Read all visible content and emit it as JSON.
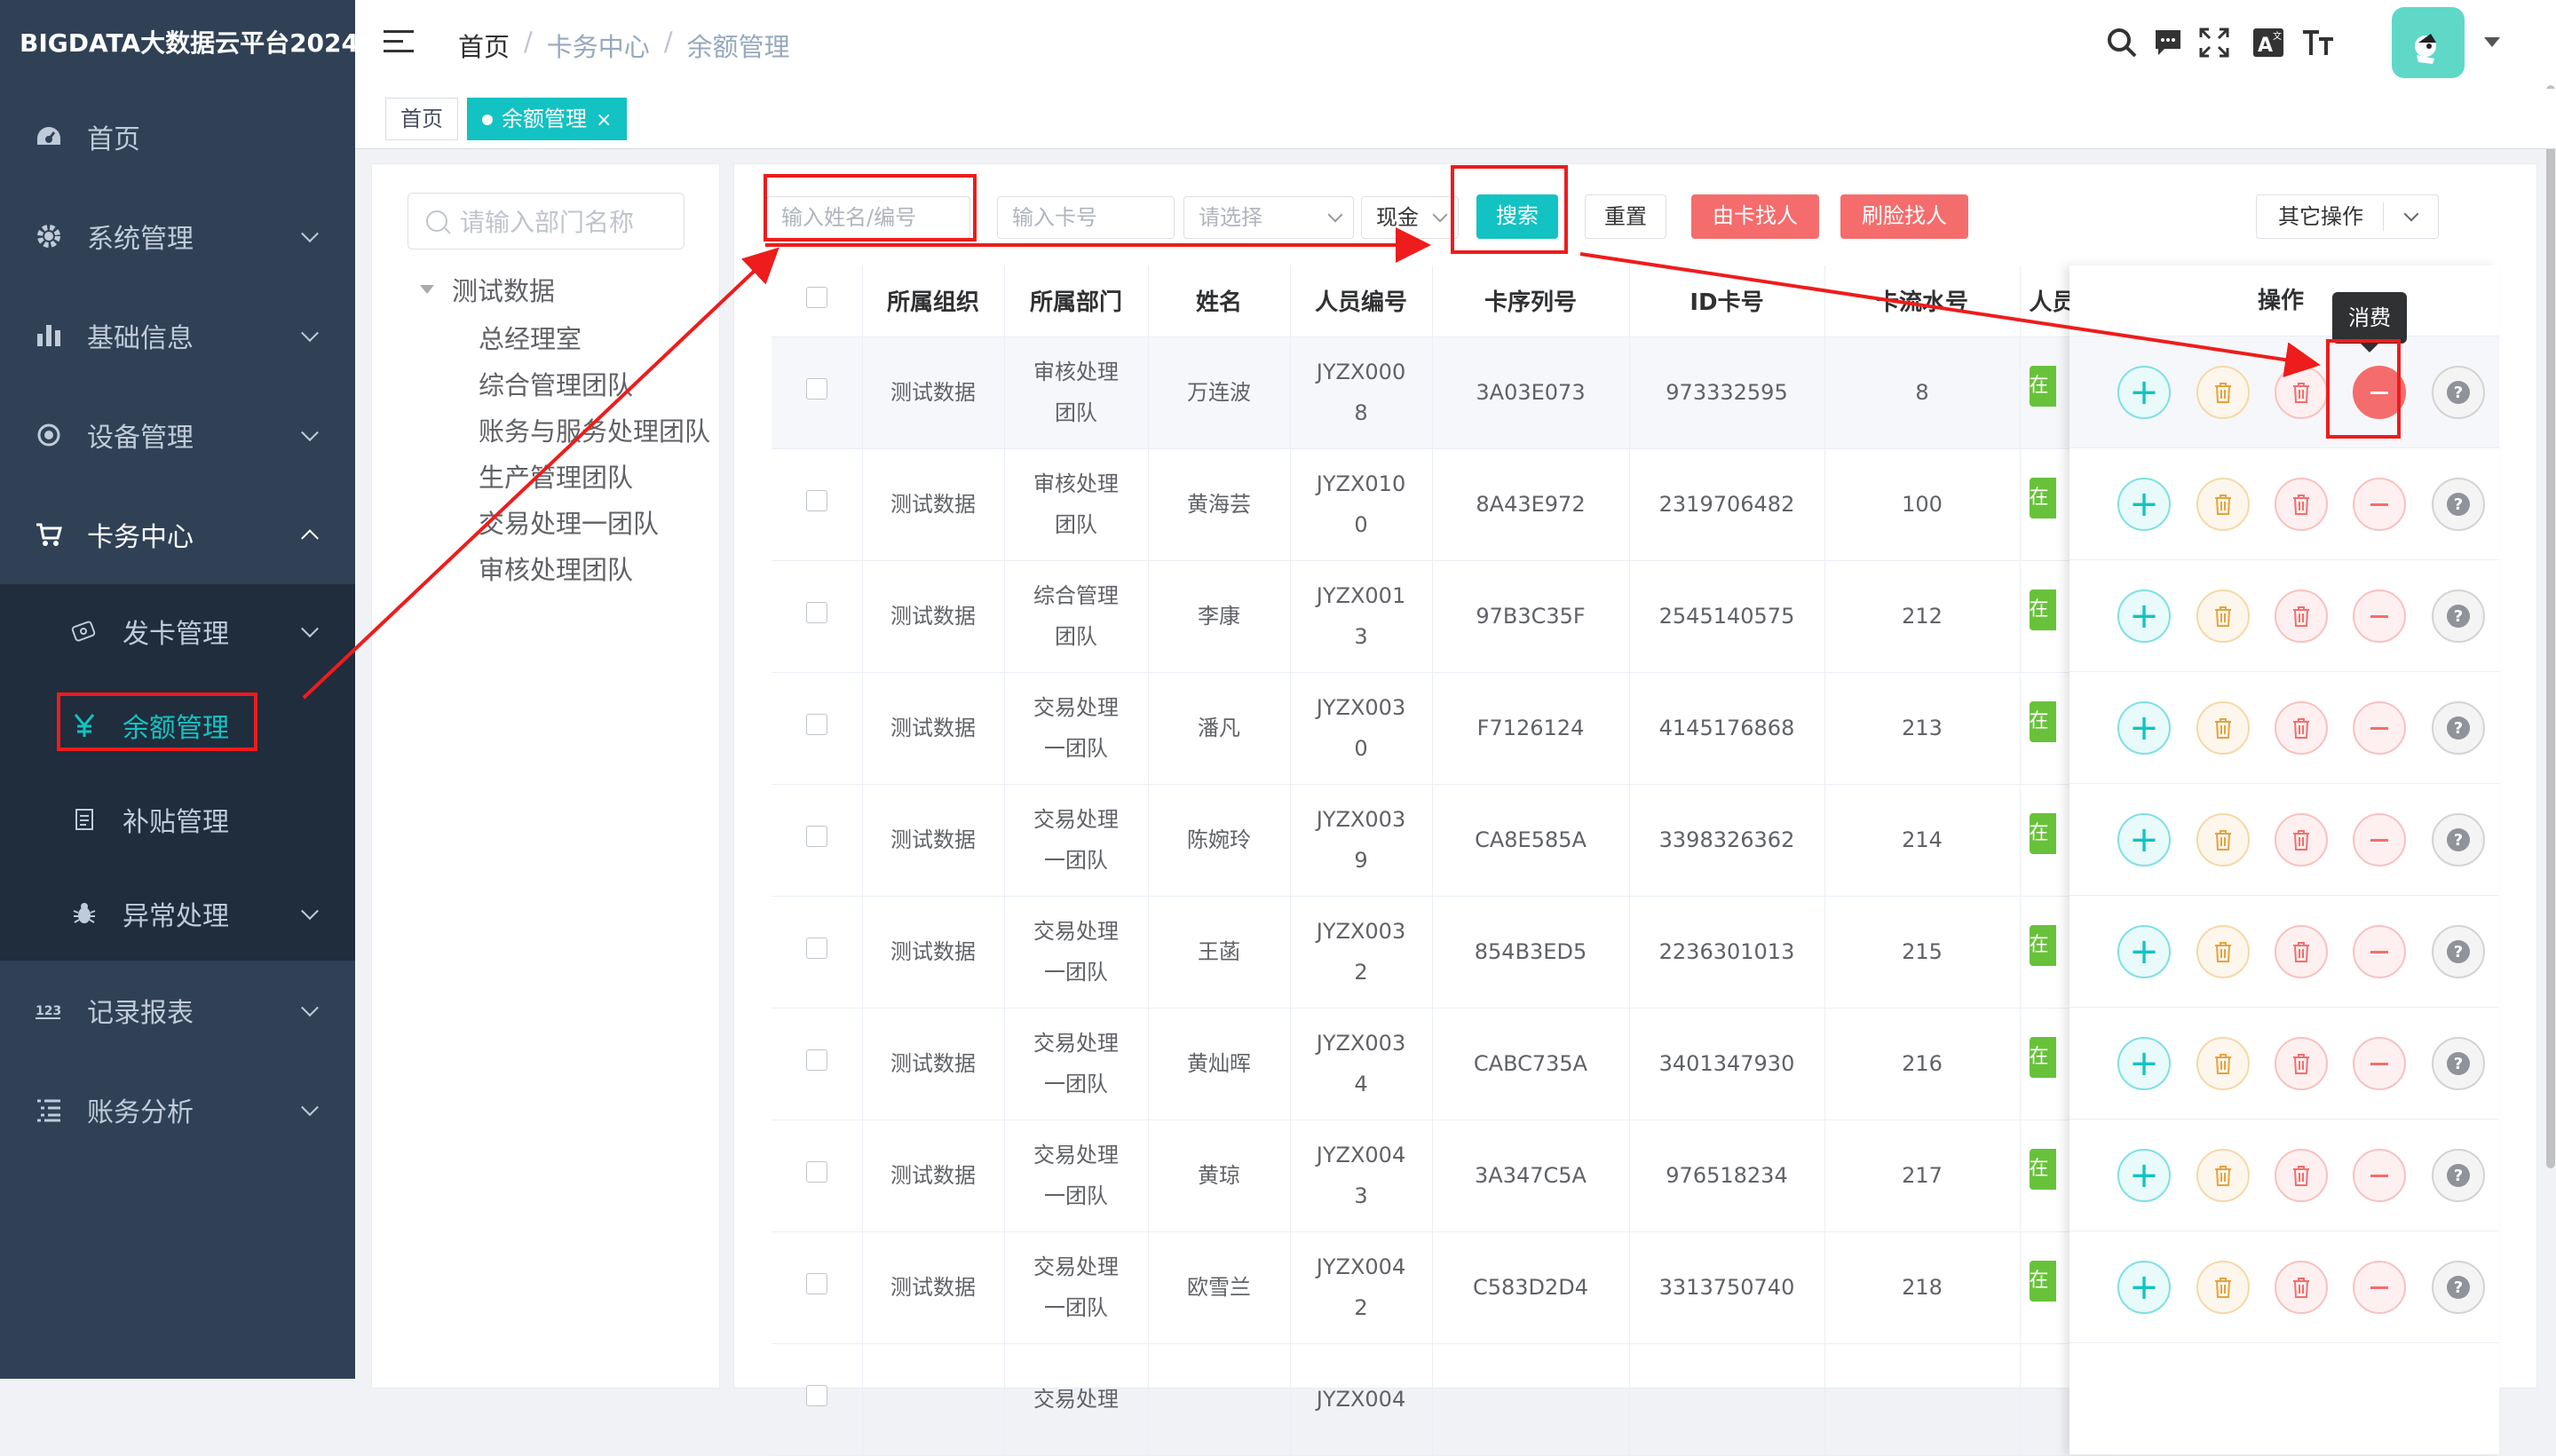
{
  "app": {
    "brand": "BIGDATA大数据云平台2024"
  },
  "sidebar": {
    "items": [
      {
        "label": "首页",
        "icon": "dashboard-icon"
      },
      {
        "label": "系统管理",
        "icon": "gear-icon"
      },
      {
        "label": "基础信息",
        "icon": "bar-chart-icon"
      },
      {
        "label": "设备管理",
        "icon": "target-icon"
      },
      {
        "label": "卡务中心",
        "icon": "cart-icon"
      },
      {
        "label": "记录报表",
        "icon": "number-icon"
      },
      {
        "label": "账务分析",
        "icon": "list-icon"
      }
    ],
    "submenu": [
      {
        "label": "发卡管理",
        "icon": "card-icon"
      },
      {
        "label": "余额管理",
        "icon": "yen-icon"
      },
      {
        "label": "补贴管理",
        "icon": "document-icon"
      },
      {
        "label": "异常处理",
        "icon": "bug-icon"
      }
    ]
  },
  "breadcrumb": [
    "首页",
    "卡务中心",
    "余额管理"
  ],
  "tags": {
    "home": "首页",
    "current": "余额管理",
    "close": "×"
  },
  "tree": {
    "search_placeholder": "请输入部门名称",
    "root": "测试数据",
    "children": [
      "总经理室",
      "综合管理团队",
      "账务与服务处理团队",
      "生产管理团队",
      "交易处理一团队",
      "审核处理团队"
    ]
  },
  "filters": {
    "name_placeholder": "输入姓名/编号",
    "card_placeholder": "输入卡号",
    "select_placeholder": "请选择",
    "cash_value": "现金",
    "search_label": "搜索",
    "reset_label": "重置",
    "find_by_card_label": "由卡找人",
    "face_find_label": "刷脸找人",
    "other_ops_label": "其它操作"
  },
  "table": {
    "headers": [
      "所属组织",
      "所属部门",
      "姓名",
      "人员编号",
      "卡序列号",
      "ID卡号",
      "卡流水号",
      "人员"
    ],
    "ops_header": "操作",
    "rows": [
      {
        "org": "测试数据",
        "dept": [
          "审核处理",
          "团队"
        ],
        "name": "万连波",
        "emp_no": [
          "JYZX000",
          "8"
        ],
        "serial": "3A03E073",
        "id_card": "973332595",
        "flow": "8",
        "status": "在"
      },
      {
        "org": "测试数据",
        "dept": [
          "审核处理",
          "团队"
        ],
        "name": "黄海芸",
        "emp_no": [
          "JYZX010",
          "0"
        ],
        "serial": "8A43E972",
        "id_card": "2319706482",
        "flow": "100",
        "status": "在"
      },
      {
        "org": "测试数据",
        "dept": [
          "综合管理",
          "团队"
        ],
        "name": "李康",
        "emp_no": [
          "JYZX001",
          "3"
        ],
        "serial": "97B3C35F",
        "id_card": "2545140575",
        "flow": "212",
        "status": "在"
      },
      {
        "org": "测试数据",
        "dept": [
          "交易处理",
          "一团队"
        ],
        "name": "潘凡",
        "emp_no": [
          "JYZX003",
          "0"
        ],
        "serial": "F7126124",
        "id_card": "4145176868",
        "flow": "213",
        "status": "在"
      },
      {
        "org": "测试数据",
        "dept": [
          "交易处理",
          "一团队"
        ],
        "name": "陈婉玲",
        "emp_no": [
          "JYZX003",
          "9"
        ],
        "serial": "CA8E585A",
        "id_card": "3398326362",
        "flow": "214",
        "status": "在"
      },
      {
        "org": "测试数据",
        "dept": [
          "交易处理",
          "一团队"
        ],
        "name": "王菡",
        "emp_no": [
          "JYZX003",
          "2"
        ],
        "serial": "854B3ED5",
        "id_card": "2236301013",
        "flow": "215",
        "status": "在"
      },
      {
        "org": "测试数据",
        "dept": [
          "交易处理",
          "一团队"
        ],
        "name": "黄灿晖",
        "emp_no": [
          "JYZX003",
          "4"
        ],
        "serial": "CABC735A",
        "id_card": "3401347930",
        "flow": "216",
        "status": "在"
      },
      {
        "org": "测试数据",
        "dept": [
          "交易处理",
          "一团队"
        ],
        "name": "黄琼",
        "emp_no": [
          "JYZX004",
          "3"
        ],
        "serial": "3A347C5A",
        "id_card": "976518234",
        "flow": "217",
        "status": "在"
      },
      {
        "org": "测试数据",
        "dept": [
          "交易处理",
          "一团队"
        ],
        "name": "欧雪兰",
        "emp_no": [
          "JYZX004",
          "2"
        ],
        "serial": "C583D2D4",
        "id_card": "3313750740",
        "flow": "218",
        "status": "在"
      },
      {
        "org": "",
        "dept": [
          "交易处理",
          ""
        ],
        "name": "",
        "emp_no": [
          "JYZX004",
          ""
        ],
        "serial": "",
        "id_card": "",
        "flow": "",
        "status": ""
      }
    ]
  },
  "tooltip": "消费",
  "colors": {
    "sidebar": "#304156",
    "submenu": "#1f2d3d",
    "accent": "#13c2c2",
    "danger": "#f56c6c",
    "annotation": "#ee1c1c"
  }
}
